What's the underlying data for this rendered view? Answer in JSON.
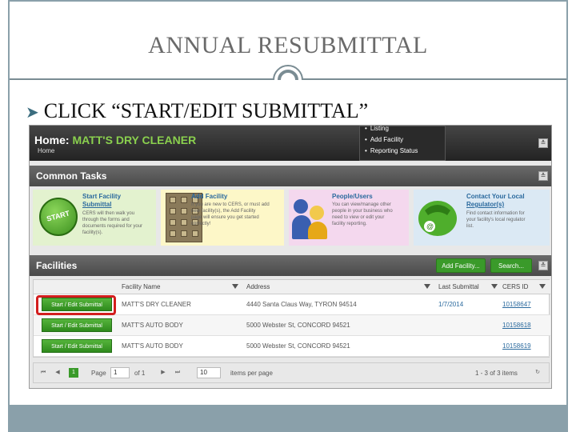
{
  "slide": {
    "title": "ANNUAL RESUBMITTAL",
    "bullet": "CLICK “START/EDIT SUBMITTAL”"
  },
  "app": {
    "home": {
      "label": "Home:",
      "facility_name": "MATT'S DRY CLEANER",
      "breadcrumb": "Home"
    },
    "menu": [
      "Listing",
      "Add Facility",
      "Reporting Status"
    ],
    "common_tasks": {
      "title": "Common Tasks",
      "cards": [
        {
          "title_1": "Start Facility",
          "title_2": "Submittal",
          "text": [
            "CERS will then walk you",
            "through the forms and",
            "documents required for your",
            "facility(s)."
          ],
          "icon": "start-button-icon",
          "bg": "green"
        },
        {
          "title_1": "Add Facility",
          "title_2": "",
          "text": [
            "If you are new to CERS, or must add",
            "new facility(s), the Add Facility",
            "page will ensure you get started",
            "correctly!"
          ],
          "icon": "file-cabinet-icon",
          "bg": "yellow"
        },
        {
          "title_1": "People/Users",
          "title_2": "",
          "text": [
            "You can view/manage other",
            "people in your business who",
            "need to view or edit your",
            "facility reporting."
          ],
          "icon": "people-icon",
          "bg": "pink"
        },
        {
          "title_1": "Contact Your Local",
          "title_2": "Regulator(s)",
          "text": [
            "Find contact information for",
            "your facility's local regulator",
            "list."
          ],
          "icon": "phone-icon",
          "bg": "blue"
        }
      ]
    },
    "facilities": {
      "title": "Facilities",
      "add_button": "Add Facility...",
      "search_button": "Search...",
      "columns": [
        "Facility Name",
        "Address",
        "Last Submittal",
        "CERS ID"
      ],
      "rows": [
        {
          "button": "Start / Edit Submittal",
          "name": "MATT'S DRY CLEANER",
          "address": "4440 Santa Claus Way, TYRON 94514",
          "last_submittal": "1/7/2014",
          "cers_id": "10158647"
        },
        {
          "button": "Start / Edit Submittal",
          "name": "MATT'S AUTO BODY",
          "address": "5000 Webster St, CONCORD 94521",
          "last_submittal": "",
          "cers_id": "10158618"
        },
        {
          "button": "Start / Edit Submittal",
          "name": "MATT'S AUTO BODY",
          "address": "5000 Webster St, CONCORD 94521",
          "last_submittal": "",
          "cers_id": "10158619"
        }
      ]
    },
    "pager": {
      "current_page": "1",
      "page_label": "Page",
      "page_input": "1",
      "of_label": "of 1",
      "page_size": "10",
      "items_per_page": "items per page",
      "range": "1 - 3 of 3 items"
    }
  },
  "colors": {
    "accent_green": "#3a9a2a",
    "highlight_red": "#d31e1e",
    "frame": "#8aa0aa"
  }
}
